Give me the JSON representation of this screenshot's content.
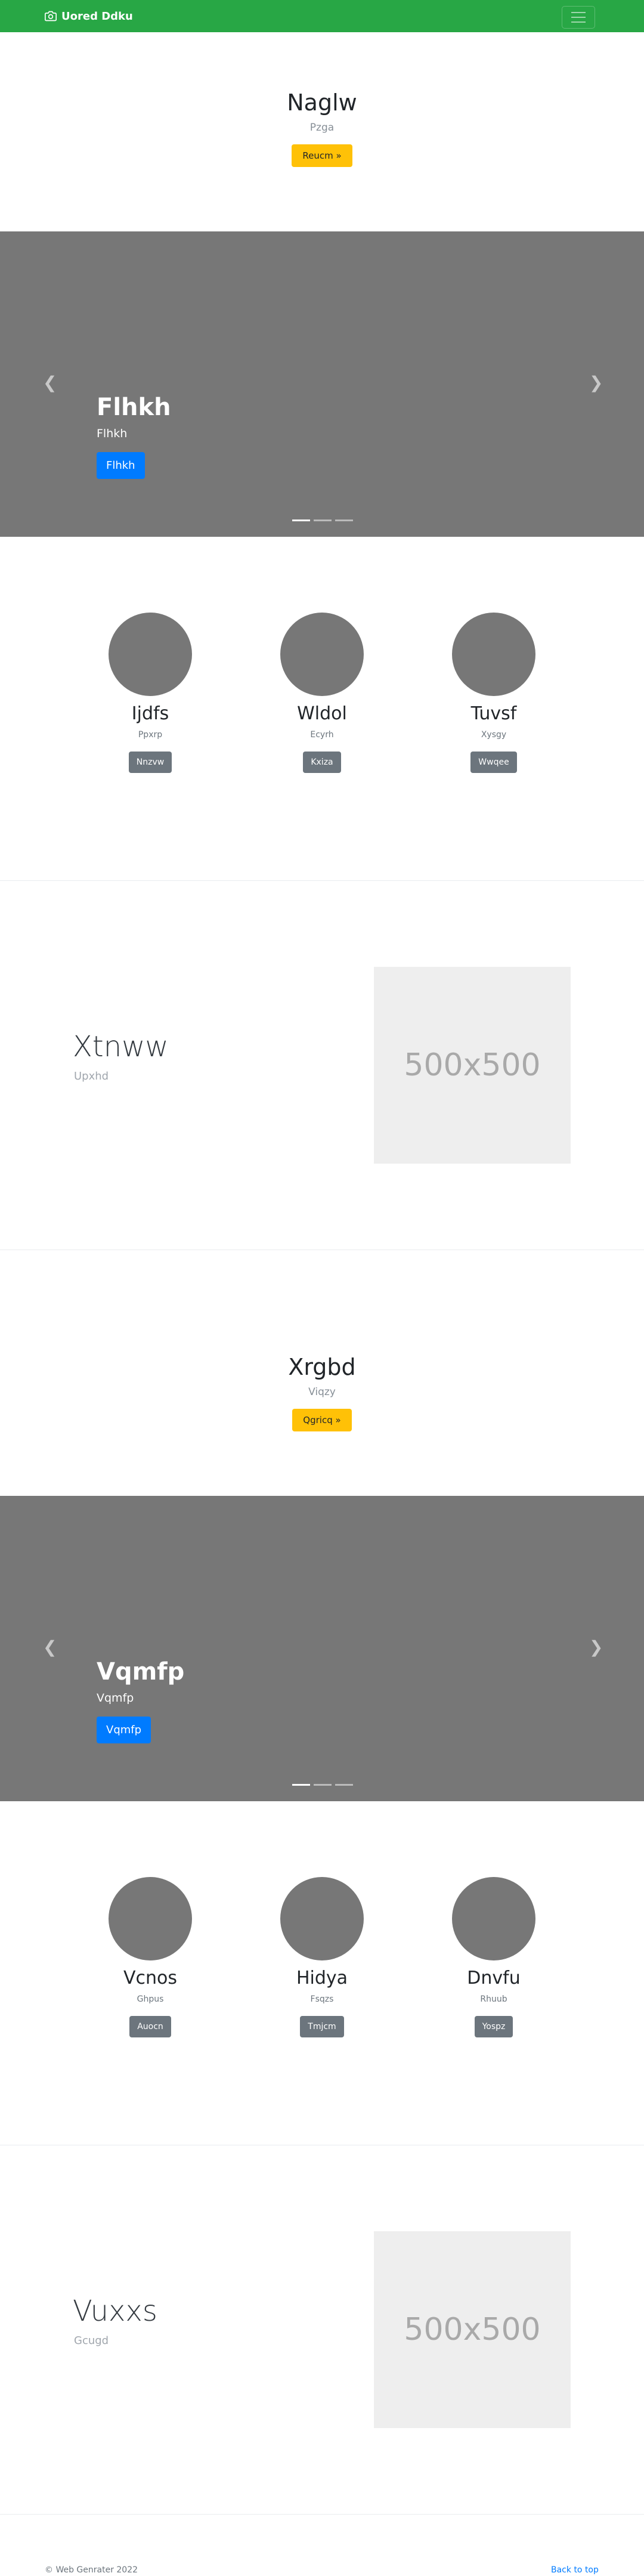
{
  "navbar": {
    "brand": "Uored Ddku",
    "brand_icon": "camera-icon",
    "toggler_icon": "hamburger-icon",
    "color": "#28a745"
  },
  "sections": {
    "hero1": {
      "title": "Naglw",
      "subtitle": "Pzga",
      "button": "Reucm »"
    },
    "carousel1": {
      "title": "Flhkh",
      "text": "Flhkh",
      "button": "Flhkh",
      "prev_icon": "chevron-left-icon",
      "next_icon": "chevron-right-icon",
      "slides": 3,
      "active_slide": 1
    },
    "features1": [
      {
        "title": "Ijdfs",
        "text": "Ppxrp",
        "button": "Nnzvw"
      },
      {
        "title": "Wldol",
        "text": "Ecyrh",
        "button": "Kxiza"
      },
      {
        "title": "Tuvsf",
        "text": "Xysgy",
        "button": "Wwqee"
      }
    ],
    "feature_row1": {
      "title": "Xtnww",
      "subtitle": "Upxhd",
      "image_text": "500x500"
    },
    "hero2": {
      "title": "Xrgbd",
      "subtitle": "Viqzy",
      "button": "Qgricq »"
    },
    "carousel2": {
      "title": "Vqmfp",
      "text": "Vqmfp",
      "button": "Vqmfp",
      "prev_icon": "chevron-left-icon",
      "next_icon": "chevron-right-icon",
      "slides": 3,
      "active_slide": 1
    },
    "features2": [
      {
        "title": "Vcnos",
        "text": "Ghpus",
        "button": "Auocn"
      },
      {
        "title": "Hidya",
        "text": "Fsqzs",
        "button": "Tmjcm"
      },
      {
        "title": "Dnvfu",
        "text": "Rhuub",
        "button": "Yospz"
      }
    ],
    "feature_row2": {
      "title": "Vuxxs",
      "subtitle": "Gcugd",
      "image_text": "500x500"
    }
  },
  "footer": {
    "copyright": "© Web Genrater 2022",
    "back_to_top": "Back to top"
  }
}
